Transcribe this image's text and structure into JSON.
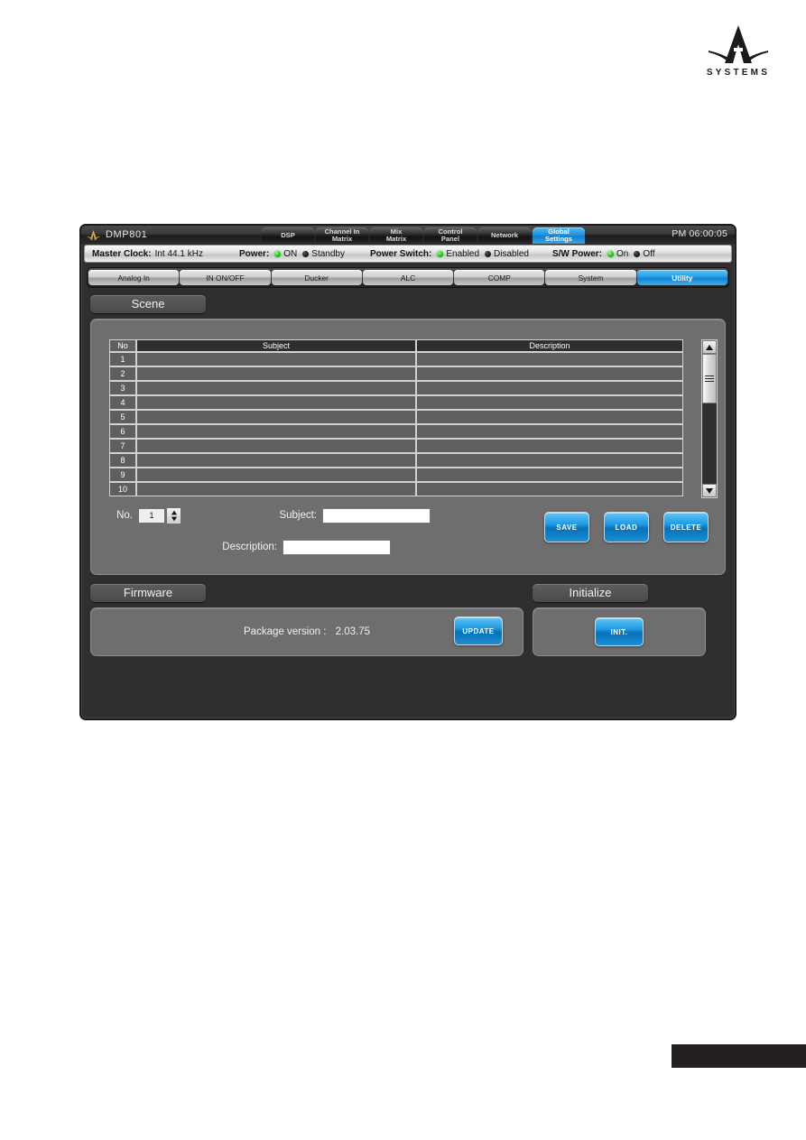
{
  "page": {
    "brand_logo_word": "SYSTEMS"
  },
  "window": {
    "app_title": "DMP801",
    "clock": "PM 06:00:05",
    "main_tabs": [
      {
        "label": "DSP",
        "line2": "",
        "active": false
      },
      {
        "label": "Channel In",
        "line2": "Matrix",
        "active": false
      },
      {
        "label": "Mix",
        "line2": "Matrix",
        "active": false
      },
      {
        "label": "Control",
        "line2": "Panel",
        "active": false
      },
      {
        "label": "Network",
        "line2": "",
        "active": false
      },
      {
        "label": "Global",
        "line2": "Settings",
        "active": true
      }
    ],
    "status": {
      "master_clock_label": "Master Clock:",
      "master_clock_value": "Int 44.1 kHz",
      "power_label": "Power:",
      "power_on": "ON",
      "power_standby": "Standby",
      "power_switch_label": "Power Switch:",
      "power_switch_enabled": "Enabled",
      "power_switch_disabled": "Disabled",
      "sw_power_label": "S/W Power:",
      "sw_power_on": "On",
      "sw_power_off": "Off"
    },
    "sub_tabs": [
      {
        "label": "Analog In",
        "active": false
      },
      {
        "label": "IN ON/OFF",
        "active": false
      },
      {
        "label": "Ducker",
        "active": false
      },
      {
        "label": "ALC",
        "active": false
      },
      {
        "label": "COMP",
        "active": false
      },
      {
        "label": "System",
        "active": false
      },
      {
        "label": "Utility",
        "active": true
      }
    ]
  },
  "scene": {
    "section_title": "Scene",
    "columns": [
      "No",
      "Subject",
      "Description"
    ],
    "rows": [
      {
        "no": "1",
        "subject": "",
        "description": ""
      },
      {
        "no": "2",
        "subject": "",
        "description": ""
      },
      {
        "no": "3",
        "subject": "",
        "description": ""
      },
      {
        "no": "4",
        "subject": "",
        "description": ""
      },
      {
        "no": "5",
        "subject": "",
        "description": ""
      },
      {
        "no": "6",
        "subject": "",
        "description": ""
      },
      {
        "no": "7",
        "subject": "",
        "description": ""
      },
      {
        "no": "8",
        "subject": "",
        "description": ""
      },
      {
        "no": "9",
        "subject": "",
        "description": ""
      },
      {
        "no": "10",
        "subject": "",
        "description": ""
      }
    ],
    "form": {
      "no_label": "No.",
      "no_value": "1",
      "subject_label": "Subject:",
      "subject_value": "",
      "description_label": "Description:",
      "description_value": ""
    },
    "buttons": {
      "save": "SAVE",
      "load": "LOAD",
      "delete": "DELETE"
    }
  },
  "firmware": {
    "section_title": "Firmware",
    "package_version_label": "Package version :",
    "package_version_value": "2.03.75",
    "update_button": "UPDATE"
  },
  "initialize": {
    "section_title": "Initialize",
    "init_button": "INIT."
  },
  "colors": {
    "accent_blue": "#1f9ae4",
    "led_green": "#33cc33",
    "panel_gray": "#6e6e6e",
    "window_dark": "#2f2f2f"
  }
}
